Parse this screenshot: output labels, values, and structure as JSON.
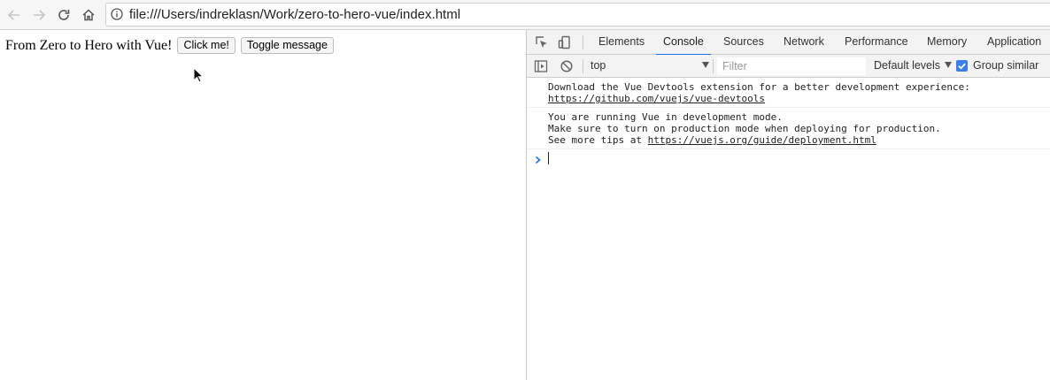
{
  "browser": {
    "url": "file:///Users/indreklasn/Work/zero-to-hero-vue/index.html",
    "icons": [
      "back-arrow-icon",
      "forward-arrow-icon",
      "reload-icon",
      "home-icon",
      "info-icon"
    ]
  },
  "page": {
    "heading": "From Zero to Hero with Vue!",
    "click_button": "Click me!",
    "toggle_button": "Toggle message"
  },
  "devtools": {
    "tabs": [
      "Elements",
      "Console",
      "Sources",
      "Network",
      "Performance",
      "Memory",
      "Application"
    ],
    "active_tab": "Console",
    "context": "top",
    "filter_placeholder": "Filter",
    "levels": "Default levels",
    "group_similar": "Group similar",
    "accent_color": "#1a73e8",
    "messages": [
      {
        "line1": "Download the Vue Devtools extension for a better development experience:",
        "link": "https://github.com/vuejs/vue-devtools"
      },
      {
        "line1": "You are running Vue in development mode.",
        "line2": "Make sure to turn on production mode when deploying for production.",
        "line3_prefix": "See more tips at ",
        "link": "https://vuejs.org/guide/deployment.html"
      }
    ]
  }
}
